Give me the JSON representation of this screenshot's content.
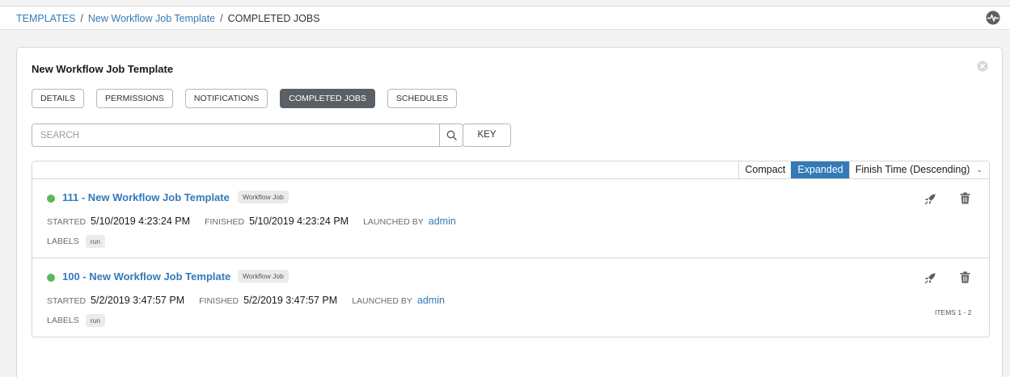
{
  "breadcrumb": {
    "items": [
      {
        "label": "TEMPLATES"
      },
      {
        "label": "New Workflow Job Template"
      },
      {
        "label": "COMPLETED JOBS"
      }
    ],
    "separator": "/"
  },
  "header": {
    "activity_icon": "activity-stream-icon"
  },
  "card": {
    "title": "New Workflow Job Template",
    "close_icon": "close-icon"
  },
  "tabs": [
    {
      "label": "DETAILS",
      "active": false
    },
    {
      "label": "PERMISSIONS",
      "active": false
    },
    {
      "label": "NOTIFICATIONS",
      "active": false
    },
    {
      "label": "COMPLETED JOBS",
      "active": true
    },
    {
      "label": "SCHEDULES",
      "active": false
    }
  ],
  "search": {
    "placeholder": "SEARCH",
    "value": "",
    "key_label": "KEY"
  },
  "list_toolbar": {
    "compact_label": "Compact",
    "expanded_label": "Expanded",
    "view_mode": "Expanded",
    "sort_label": "Finish Time (Descending)"
  },
  "jobs": [
    {
      "name": "111 - New Workflow Job Template",
      "type": "Workflow Job",
      "status": "successful",
      "status_color": "#5cb85c",
      "started_label": "STARTED",
      "started": "5/10/2019 4:23:24 PM",
      "finished_label": "FINISHED",
      "finished": "5/10/2019 4:23:24 PM",
      "launched_by_label": "LAUNCHED BY",
      "launched_by": "admin",
      "labels_label": "LABELS",
      "labels": [
        "run"
      ]
    },
    {
      "name": "100 - New Workflow Job Template",
      "type": "Workflow Job",
      "status": "successful",
      "status_color": "#5cb85c",
      "started_label": "STARTED",
      "started": "5/2/2019 3:47:57 PM",
      "finished_label": "FINISHED",
      "finished": "5/2/2019 3:47:57 PM",
      "launched_by_label": "LAUNCHED BY",
      "launched_by": "admin",
      "labels_label": "LABELS",
      "labels": [
        "run"
      ]
    }
  ],
  "pagination": {
    "items_label": "ITEMS 1 - 2"
  },
  "colors": {
    "accent": "#337ab7",
    "active_tab": "#5b6066",
    "success": "#5cb85c"
  }
}
